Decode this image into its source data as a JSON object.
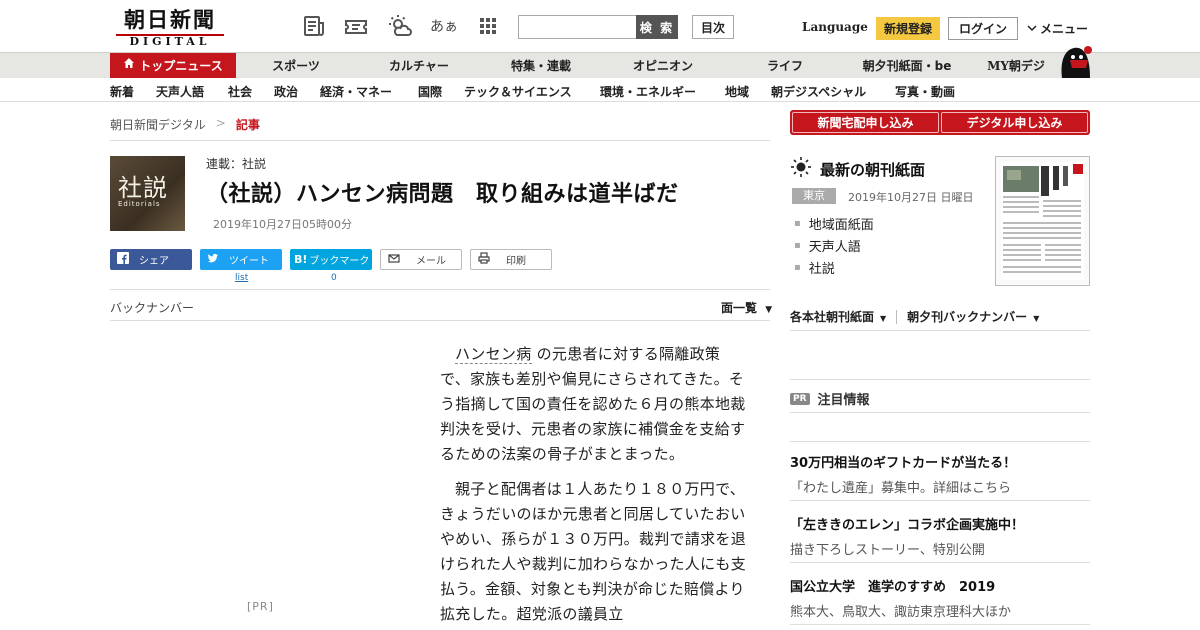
{
  "header": {
    "logo_main": "朝日新聞",
    "logo_sub": "DIGITAL",
    "icons": [
      "newspaper-icon",
      "ticket-icon",
      "weather-icon",
      "font-size-icon",
      "apps-grid-icon"
    ],
    "font_icon_text": "あぁ",
    "search_placeholder": "",
    "search_button": "検 索",
    "toc_button": "目次",
    "language_link": "Language",
    "register_button": "新規登録",
    "login_button": "ログイン",
    "menu_button": "メニュー"
  },
  "main_nav": {
    "items": [
      {
        "label": "トップニュース",
        "active": true
      },
      {
        "label": "スポーツ"
      },
      {
        "label": "カルチャー"
      },
      {
        "label": "特集・連載"
      },
      {
        "label": "オピニオン"
      },
      {
        "label": "ライフ"
      },
      {
        "label": "朝夕刊紙面・be"
      },
      {
        "label": "MY朝デジ"
      }
    ]
  },
  "sub_nav": {
    "items": [
      "新着",
      "天声人語",
      "社会",
      "政治",
      "経済・マネー",
      "国際",
      "テック＆サイエンス",
      "環境・エネルギー",
      "地域",
      "朝デジスペシャル",
      "写真・動画"
    ]
  },
  "breadcrumb": {
    "home": "朝日新聞デジタル",
    "separator": ">",
    "current": "記事"
  },
  "article": {
    "badge_kanji": "社説",
    "badge_english": "Editorials",
    "series": "連載：社説",
    "headline": "（社説）ハンセン病問題　取り組みは道半ばだ",
    "date": "2019年10月27日05時00分",
    "share": {
      "facebook": "シェア",
      "twitter": "ツイート",
      "twitter_count": "list",
      "hatena": "ブックマーク",
      "hatena_count": "0",
      "mail": "メール",
      "print": "印刷"
    },
    "backnumber": "バックナンバー",
    "page_list": "面一覧",
    "p1_link": "ハンセン病",
    "p1_rest": "の元患者に対する隔離政策で、家族も差別や偏見にさらされてきた。そう指摘して国の責任を認めた６月の熊本地裁判決を受け、元患者の家族に補償金を支給するための法案の骨子がまとまった。",
    "p2": "親子と配偶者は１人あたり１８０万円で、きょうだいのほか元患者と同居していたおいやめい、孫らが１３０万円。裁判で請求を退けられた人や裁判に加わらなかった人にも支払う。金額、対象とも判決が命じた賠償より拡充した。超党派の議員立",
    "pr_tag": "[PR]"
  },
  "sidebar": {
    "home_delivery_button": "新聞宅配申し込み",
    "digital_button": "デジタル申し込み",
    "paper_title": "最新の朝刊紙面",
    "region": "東京",
    "paper_date": "2019年10月27日 日曜日",
    "paper_links": [
      "地域面紙面",
      "天声人語",
      "社説"
    ],
    "thumb_headline": "大麻 和歌山人公",
    "dropdown_morning": "各本社朝刊紙面",
    "dropdown_evening": "朝夕刊バックナンバー",
    "pr_badge": "PR",
    "pr_title": "注目情報",
    "promos": [
      {
        "title": "30万円相当のギフトカードが当たる！",
        "sub": "「わたし遺産」募集中。詳細はこちら"
      },
      {
        "title": "「左ききのエレン」コラボ企画実施中！",
        "sub": "描き下ろしストーリー、特別公開"
      },
      {
        "title": "国公立大学　進学のすすめ　2019",
        "sub": "熊本大、鳥取大、諏訪東京理科大ほか"
      }
    ]
  },
  "colors": {
    "brand_red": "#c4161c",
    "register_yellow": "#f5c842",
    "facebook": "#3b5998",
    "twitter": "#1da1f2",
    "hatena": "#00a4de"
  }
}
